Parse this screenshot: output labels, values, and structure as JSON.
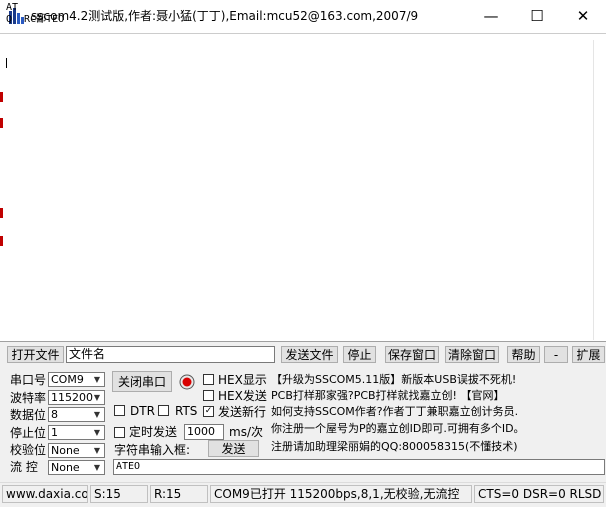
{
  "window": {
    "title": "sscom4.2测试版,作者:聂小猛(丁丁),Email:mcu52@163.com,2007/9",
    "controls": [
      "—",
      "☐",
      "✕"
    ]
  },
  "receive": {
    "lines": "AT\nQ  RC鄙TEO"
  },
  "toolbar": {
    "open_file": "打开文件",
    "file_name": "文件名",
    "send_file": "发送文件",
    "stop": "停止",
    "save_window": "保存窗口",
    "clear_window": "清除窗口",
    "help": "帮助",
    "minus": "-",
    "expand": "扩展"
  },
  "serial": {
    "port_label": "串口号",
    "port_value": "COM9",
    "baud_label": "波特率",
    "baud_value": "115200",
    "data_label": "数据位",
    "data_value": "8",
    "stop_label": "停止位",
    "stop_value": "1",
    "parity_label": "校验位",
    "parity_value": "None",
    "flow_label": "流 控",
    "flow_value": "None"
  },
  "controls": {
    "close_port": "关闭串口",
    "hex_display": "HEX显示",
    "hex_send": "HEX发送",
    "send_newline": "发送新行",
    "dtr": "DTR",
    "rts": "RTS",
    "timed_send": "定时发送",
    "interval": "1000",
    "interval_unit": "ms/次",
    "string_input_label": "字符串输入框:",
    "send": "发送",
    "input_value": "ATEO"
  },
  "ads": {
    "line1": "【升级为SSCOM5.11版】新版本USB误拔不死机!",
    "line2": "PCB打样那家强?PCB打样就找嘉立创! 【官网】",
    "line3": "如何支持SSCOM作者?作者丁丁兼职嘉立创计务员.",
    "line4": "你注册一个屋号为P的嘉立创ID即可.可拥有多个ID。",
    "line5": "注册请加助理梁丽娟的QQ:800058315(不懂技术)"
  },
  "status": {
    "site": "www.daxia.com",
    "sent": "S:15",
    "received": "R:15",
    "port_info": "COM9已打开  115200bps,8,1,无校验,无流控",
    "lines": "CTS=0 DSR=0 RLSD"
  },
  "colors": {
    "background": "#f0f0f0",
    "button": "#e1e1e1",
    "marker": "#c00000"
  }
}
